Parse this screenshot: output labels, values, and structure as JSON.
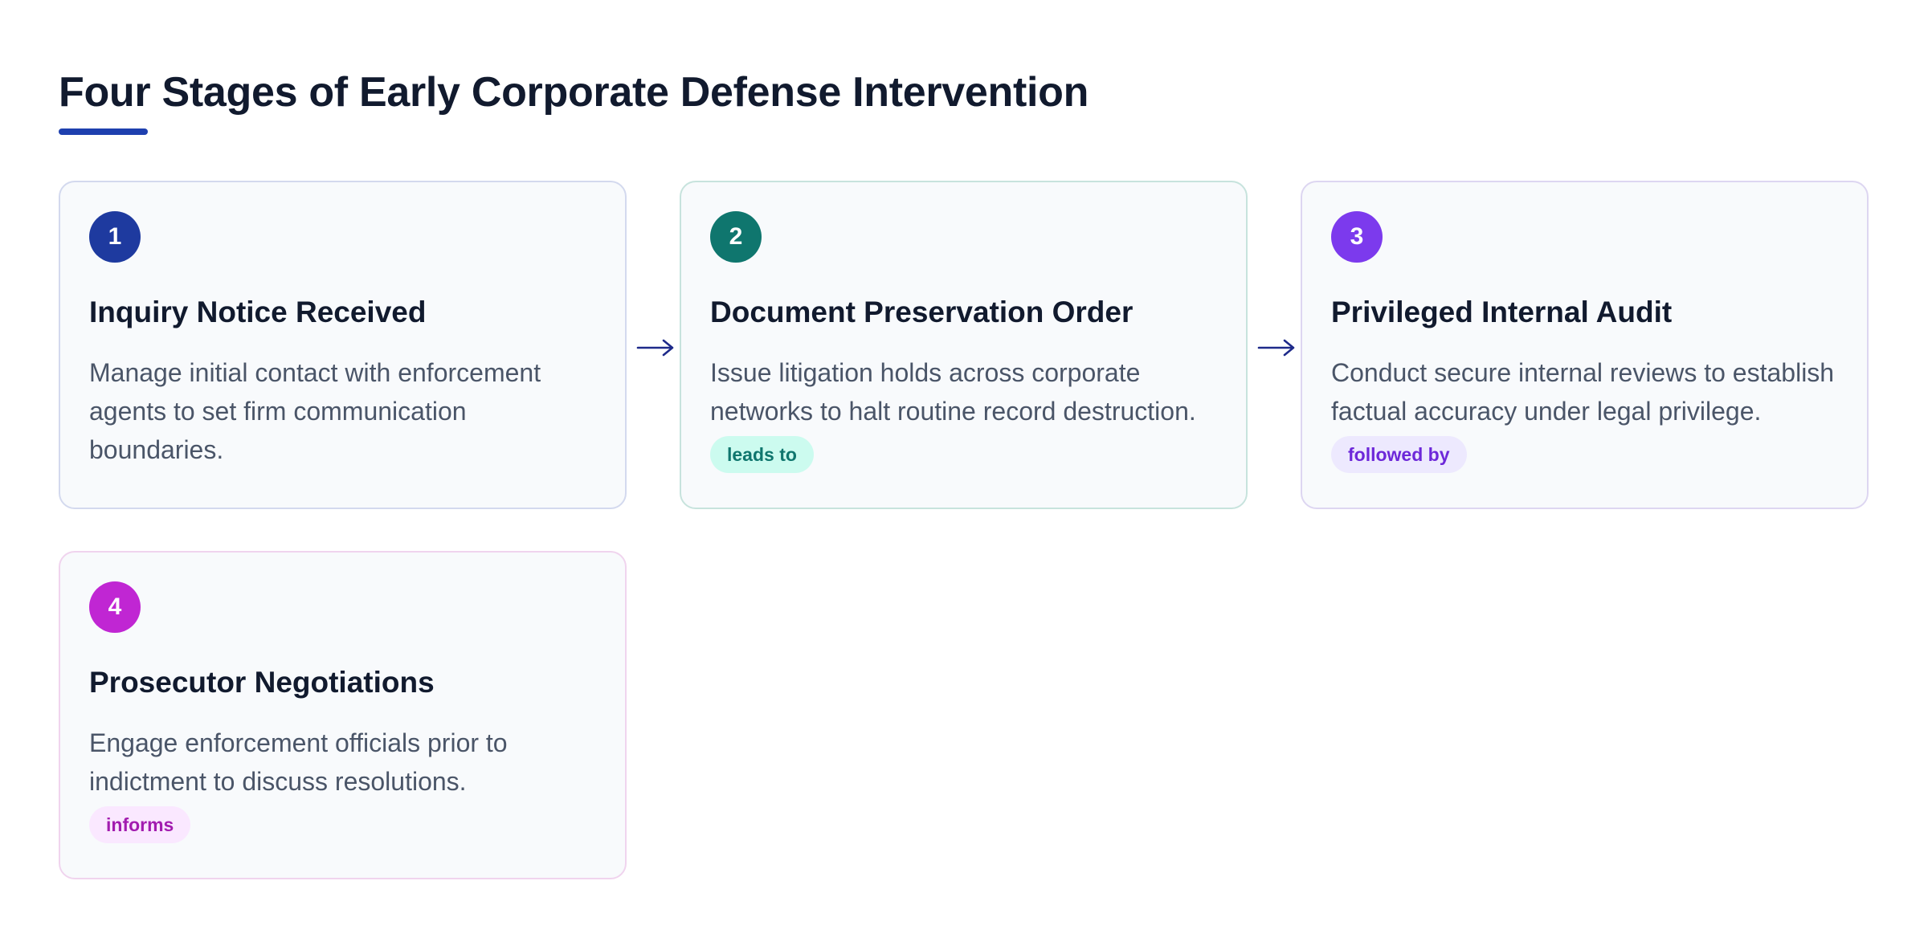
{
  "title": "Four Stages of Early Corporate Defense Intervention",
  "colors": {
    "accent": "#1e40af",
    "arrow": "#1e2a8a"
  },
  "stages": [
    {
      "number": "1",
      "title": "Inquiry Notice Received",
      "description": "Manage initial contact with enforcement agents to set firm communication boundaries.",
      "badge_color": "#1e3a9f"
    },
    {
      "number": "2",
      "title": "Document Preservation Order",
      "description": "Issue litigation holds across corporate networks to halt routine record destruction.",
      "tag": "leads to",
      "badge_color": "#0f766e",
      "tag_color": "#0f766e",
      "tag_bg": "#ccfbef"
    },
    {
      "number": "3",
      "title": "Privileged Internal Audit",
      "description": "Conduct secure internal reviews to establish factual accuracy under legal privilege.",
      "tag": "followed by",
      "badge_color": "#7c3aed",
      "tag_color": "#6d28d9",
      "tag_bg": "#ede9fe"
    },
    {
      "number": "4",
      "title": "Prosecutor Negotiations",
      "description": "Engage enforcement officials prior to indictment to discuss resolutions.",
      "tag": "informs",
      "badge_color": "#c026d3",
      "tag_color": "#a21caf",
      "tag_bg": "#fae8ff"
    }
  ],
  "connectors": [
    {
      "from": "1",
      "to": "2",
      "icon": "arrow-right-icon"
    },
    {
      "from": "2",
      "to": "3",
      "icon": "arrow-right-icon"
    }
  ]
}
